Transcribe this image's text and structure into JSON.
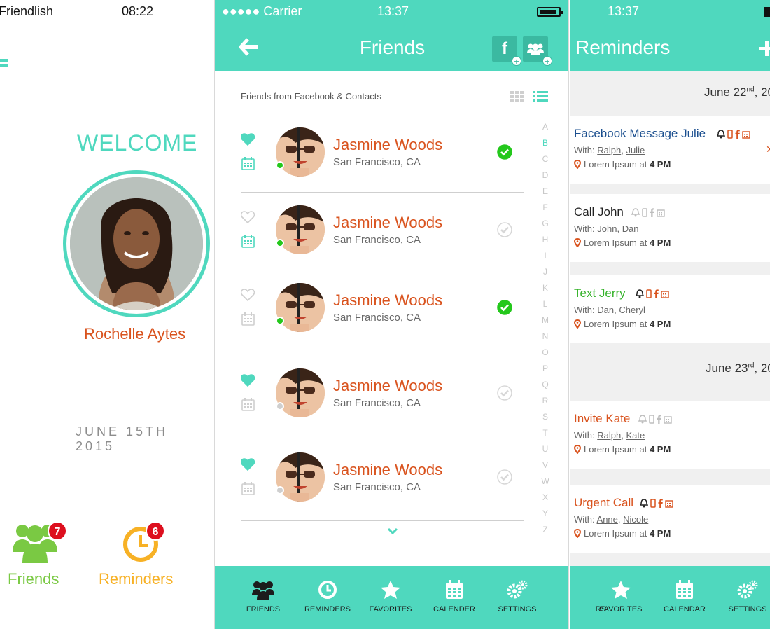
{
  "colors": {
    "accent": "#4fd8be",
    "accent_dark": "#3bb9a1",
    "name_orange": "#d9531e",
    "friends_green": "#7ac943",
    "reminders_yellow": "#f7b125",
    "badge_red": "#dd0f1e",
    "online_green": "#24c81c",
    "facebook_blue": "#1b4f8f",
    "text_green": "#36b32b"
  },
  "screen1": {
    "status": {
      "app": "Friendlish",
      "time": "08:22"
    },
    "menu_icon": "hamburger-icon",
    "welcome": "WELCOME",
    "user_name": "Rochelle Aytes",
    "date": "JUNE 15TH 2015",
    "tiles": [
      {
        "label": "Friends",
        "badge": "7",
        "icon": "group-icon"
      },
      {
        "label": "Reminders",
        "badge": "6",
        "icon": "clock-icon"
      }
    ]
  },
  "screen2": {
    "status": {
      "carrier": "●●●●● Carrier",
      "time": "13:37"
    },
    "title": "Friends",
    "subhead": "Friends from Facebook & Contacts",
    "header_buttons": [
      "facebook-add-icon",
      "group-add-icon"
    ],
    "friends": [
      {
        "name": "Jasmine Woods",
        "location": "San Francisco, CA",
        "favorite": true,
        "calendar": true,
        "online": true,
        "checked": true
      },
      {
        "name": "Jasmine Woods",
        "location": "San Francisco, CA",
        "favorite": false,
        "calendar": true,
        "online": true,
        "checked": false
      },
      {
        "name": "Jasmine Woods",
        "location": "San Francisco, CA",
        "favorite": false,
        "calendar": false,
        "online": true,
        "checked": true
      },
      {
        "name": "Jasmine Woods",
        "location": "San Francisco, CA",
        "favorite": true,
        "calendar": false,
        "online": false,
        "checked": false
      },
      {
        "name": "Jasmine Woods",
        "location": "San Francisco, CA",
        "favorite": true,
        "calendar": false,
        "online": false,
        "checked": false
      }
    ],
    "alphabet": [
      "A",
      "B",
      "C",
      "D",
      "E",
      "F",
      "G",
      "H",
      "I",
      "J",
      "K",
      "L",
      "M",
      "N",
      "O",
      "P",
      "Q",
      "R",
      "S",
      "T",
      "U",
      "V",
      "W",
      "X",
      "Y",
      "Z"
    ],
    "alphabet_active": "B",
    "tabs": [
      "FRIENDS",
      "REMINDERS",
      "FAVORITES",
      "CALENDER",
      "SETTINGS"
    ]
  },
  "screen3": {
    "status": {
      "time": "13:37"
    },
    "title": "Reminders",
    "days": [
      {
        "label": "June 22",
        "suffix": "nd",
        "tail": ", 20",
        "reminders": [
          {
            "title": "Facebook Message Julie",
            "color": "#1b4f8f",
            "with_label": "With:",
            "people": [
              "Ralph",
              "Julie"
            ],
            "location": "Lorem Ipsum at",
            "time": "4 PM",
            "icons_active": true
          },
          {
            "title": "Call John",
            "color": "#222222",
            "with_label": "With:",
            "people": [
              "John",
              "Dan"
            ],
            "location": "Lorem Ipsum at",
            "time": "4 PM",
            "icons_active": false
          },
          {
            "title": "Text Jerry",
            "color": "#36b32b",
            "with_label": "With:",
            "people": [
              "Dan",
              "Cheryl"
            ],
            "location": "Lorem Ipsum at",
            "time": "4 PM",
            "icons_active": true
          }
        ]
      },
      {
        "label": "June 23",
        "suffix": "rd",
        "tail": ", 20",
        "reminders": [
          {
            "title": "Invite Kate",
            "color": "#d9531e",
            "with_label": "With:",
            "people": [
              "Ralph",
              "Kate"
            ],
            "location": "Lorem Ipsum at",
            "time": "4 PM",
            "icons_active": false
          },
          {
            "title": "Urgent Call",
            "color": "#d9531e",
            "with_label": "With:",
            "people": [
              "Anne",
              "Nicole"
            ],
            "location": "Lorem Ipsum at",
            "time": "4 PM",
            "icons_active": true
          }
        ]
      }
    ],
    "tabs": [
      "RS",
      "FAVORITES",
      "CALENDAR",
      "SETTINGS"
    ]
  }
}
